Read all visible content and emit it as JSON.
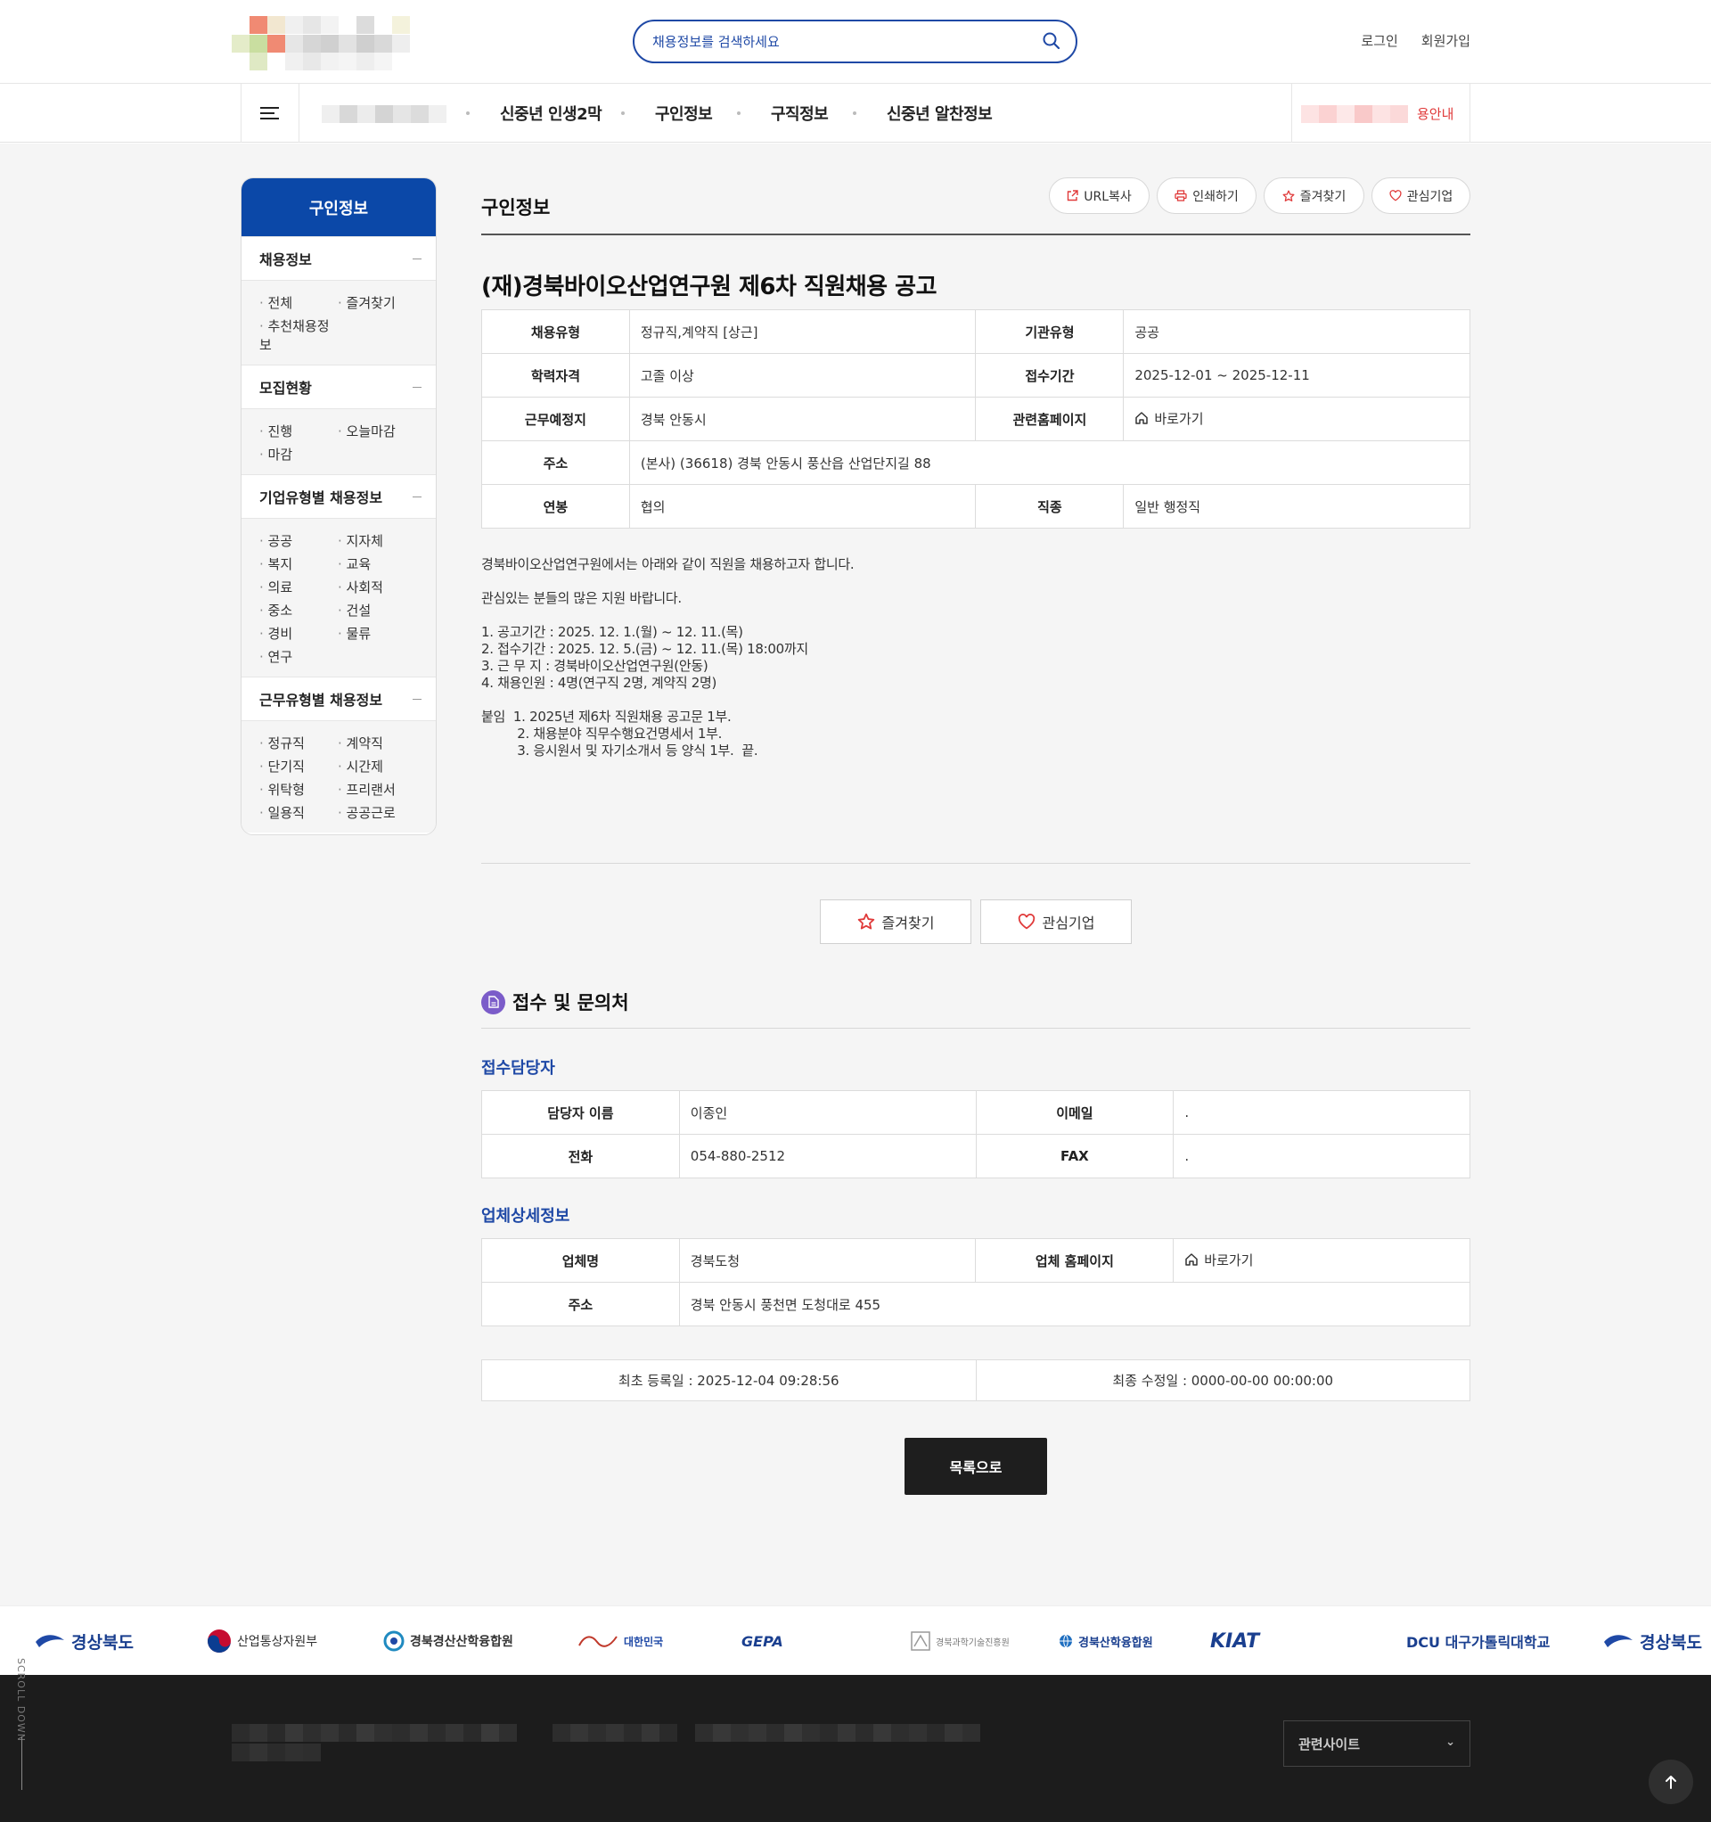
{
  "header": {
    "search_placeholder": "채용정보를 검색하세요",
    "login": "로그인",
    "signup": "회원가입"
  },
  "gnb": {
    "menus": [
      "신중년 인생2막",
      "구인정보",
      "구직정보",
      "신중년 알찬정보"
    ],
    "right_label": "용안내"
  },
  "sidebar": {
    "title": "구인정보",
    "groups": [
      {
        "title": "채용정보",
        "items": [
          "전체",
          "즐겨찾기",
          "추천채용정보"
        ]
      },
      {
        "title": "모집현황",
        "items": [
          "진행",
          "오늘마감",
          "마감"
        ]
      },
      {
        "title": "기업유형별 채용정보",
        "items": [
          "공공",
          "지자체",
          "복지",
          "교육",
          "의료",
          "사회적",
          "중소",
          "건설",
          "경비",
          "물류",
          "연구"
        ]
      },
      {
        "title": "근무유형별 채용정보",
        "items": [
          "정규직",
          "계약직",
          "단기직",
          "시간제",
          "위탁형",
          "프리랜서",
          "일용직",
          "공공근로"
        ]
      }
    ]
  },
  "main": {
    "title": "구인정보",
    "tools": {
      "url_copy": "URL복사",
      "print": "인쇄하기",
      "favorite": "즐겨찾기",
      "interest": "관심기업"
    },
    "job_title": "(재)경북바이오산업연구원 제6차 직원채용 공고",
    "info": {
      "employment_type_label": "채용유형",
      "employment_type": "정규직,계약직 [상근]",
      "org_type_label": "기관유형",
      "org_type": "공공",
      "education_label": "학력자격",
      "education": "고졸 이상",
      "period_label": "접수기간",
      "period": "2025-12-01 ~ 2025-12-11",
      "location_label": "근무예정지",
      "location": "경북 안동시",
      "homepage_label": "관련홈페이지",
      "homepage": "바로가기",
      "address_label": "주소",
      "address": "(본사) (36618) 경북 안동시 풍산읍 산업단지길 88",
      "salary_label": "연봉",
      "salary": "협의",
      "job_label": "직종",
      "job": "일반 행정직"
    },
    "description": "경북바이오산업연구원에서는 아래와 같이 직원을 채용하고자 합니다.\n\n관심있는 분들의 많은 지원 바랍니다.\n\n1. 공고기간 : 2025. 12. 1.(월) ~ 12. 11.(목)\n2. 접수기간 : 2025. 12. 5.(금) ~ 12. 11.(목) 18:00까지\n3. 근 무 지 : 경북바이오산업연구원(안동)\n4. 채용인원 : 4명(연구직 2명, 계약직 2명)\n\n붙임  1. 2025년 제6차 직원채용 공고문 1부.\n         2. 채용분야 직무수행요건명세서 1부.\n         3. 응시원서 및 자기소개서 등 양식 1부.  끝.",
    "favorite_btn": "즐겨찾기",
    "interest_btn": "관심기업",
    "contact_section": "접수 및 문의처",
    "contact_sub": "접수담당자",
    "contact": {
      "name_label": "담당자 이름",
      "name": "이종인",
      "email_label": "이메일",
      "email": ".",
      "phone_label": "전화",
      "phone": "054-880-2512",
      "fax_label": "FAX",
      "fax": "."
    },
    "company_sub": "업체상세정보",
    "company": {
      "name_label": "업체명",
      "name": "경북도청",
      "homepage_label": "업체 홈페이지",
      "homepage": "바로가기",
      "address_label": "주소",
      "address": "경북 안동시 풍천면 도청대로 455"
    },
    "registered": "최초 등록일 : 2025-12-04 09:28:56",
    "modified": "최종 수정일 : 0000-00-00 00:00:00",
    "list_btn": "목록으로"
  },
  "partners": {
    "logos": [
      "경상북도",
      "산업통상자원부",
      "경북경산산학융합원",
      "대한민국",
      "GEPA",
      "경북과학기술진흥원",
      "경북산학융합원",
      "KIAT",
      "DCU 대구가톨릭대학교",
      "경상북도"
    ],
    "scroll_label": "SCROLL DOWN"
  },
  "footer": {
    "related_sites": "관련사이트"
  },
  "colors": {
    "primary": "#0b48a8",
    "accent_red": "#e03a3a",
    "section_icon": "#7b5cc9",
    "dark": "#1e1e1e"
  }
}
